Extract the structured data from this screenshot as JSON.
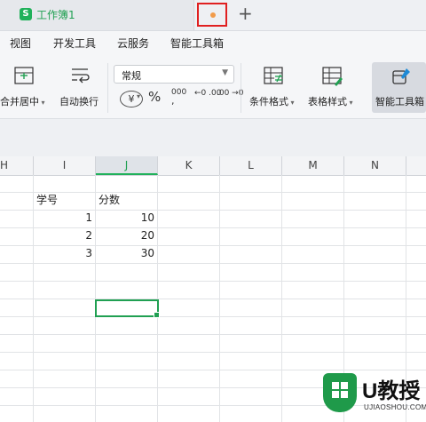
{
  "tabs": {
    "logo": "S",
    "title": "工作簿1",
    "new_tab": "+"
  },
  "menu": [
    "视图",
    "开发工具",
    "云服务",
    "智能工具箱"
  ],
  "ribbon": {
    "merge_center": "合并居中",
    "wrap_text": "自动换行",
    "number_format": "常规",
    "currency": "¥",
    "percent": "%",
    "thousands": "000",
    "dec_increase": "←0 .00",
    "dec_decrease": ".00 →0",
    "conditional_format": "条件格式",
    "table_style": "表格样式",
    "smart_toolbox": "智能工具箱"
  },
  "columns": [
    "H",
    "I",
    "J",
    "K",
    "L",
    "M",
    "N"
  ],
  "active_column": "J",
  "cells": {
    "i1": "学号",
    "j1": "分数",
    "i2": "1",
    "j2": "10",
    "i3": "2",
    "j3": "20",
    "i4": "3",
    "j4": "30"
  },
  "watermark": {
    "brand": "U教授",
    "site": "UJIAOSHOU.COM"
  },
  "colors": {
    "accent": "#20b15a",
    "unsaved_highlight": "#e02020",
    "unsaved_dot": "#f19b4a"
  }
}
